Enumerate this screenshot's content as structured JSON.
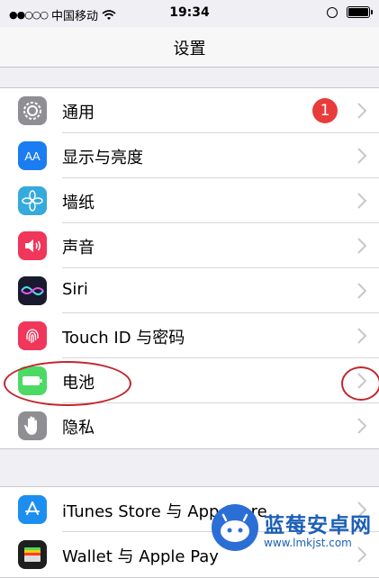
{
  "status_bar": {
    "signal": "●●○○○",
    "carrier": "中国移动",
    "time": "19:34",
    "battery_level": 0.95
  },
  "header": {
    "title": "设置"
  },
  "groups": [
    {
      "items": [
        {
          "label": "通用",
          "icon": "gear-icon",
          "icon_color": "#8e8e93",
          "badge": "1"
        },
        {
          "label": "显示与亮度",
          "icon": "display-aa-icon",
          "icon_color": "#1c7cf2"
        },
        {
          "label": "墙纸",
          "icon": "wallpaper-flower-icon",
          "icon_color": "#35aadc"
        },
        {
          "label": "声音",
          "icon": "speaker-icon",
          "icon_color": "#f0365a"
        },
        {
          "label": "Siri",
          "icon": "siri-icon",
          "icon_color": "#1a1a2e"
        },
        {
          "label": "Touch ID 与密码",
          "icon": "fingerprint-icon",
          "icon_color": "#f0365a"
        },
        {
          "label": "电池",
          "icon": "battery-icon",
          "icon_color": "#4cd964"
        },
        {
          "label": "隐私",
          "icon": "hand-icon",
          "icon_color": "#8e8e93"
        }
      ]
    },
    {
      "items": [
        {
          "label": "iTunes Store 与 App Store",
          "icon": "app-store-icon",
          "icon_color": "#1c8ef0"
        },
        {
          "label": "Wallet 与 Apple Pay",
          "icon": "wallet-icon",
          "icon_color": "#1f1f1f"
        }
      ]
    }
  ],
  "watermark": {
    "title": "蓝莓安卓网",
    "url": "www.lmkjst.com"
  },
  "accent_colors": {
    "annotation": "#c0272d",
    "badge": "#e83c3c"
  }
}
